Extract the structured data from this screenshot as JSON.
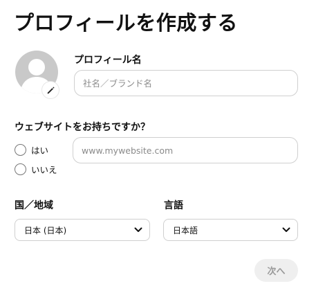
{
  "page": {
    "title": "プロフィールを作成する"
  },
  "profile": {
    "name_label": "プロフィール名",
    "name_value": "",
    "name_placeholder": "社名／ブランド名",
    "avatar_icon": "default-user-icon",
    "edit_icon": "pencil-icon"
  },
  "website": {
    "question": "ウェブサイトをお持ちですか？",
    "options": [
      {
        "label": "はい",
        "selected": false
      },
      {
        "label": "いいえ",
        "selected": false
      }
    ],
    "url_value": "",
    "url_placeholder": "www.mywebsite.com"
  },
  "country": {
    "label": "国／地域",
    "selected": "日本 (日本)",
    "icon": "chevron-down-icon"
  },
  "language": {
    "label": "言語",
    "selected": "日本語",
    "icon": "chevron-down-icon"
  },
  "actions": {
    "next_label": "次へ"
  },
  "colors": {
    "border": "#cfcfcf",
    "avatar": "#c9c9c9",
    "disabled_button_bg": "#efefef",
    "disabled_button_text": "#9a9a9a"
  }
}
